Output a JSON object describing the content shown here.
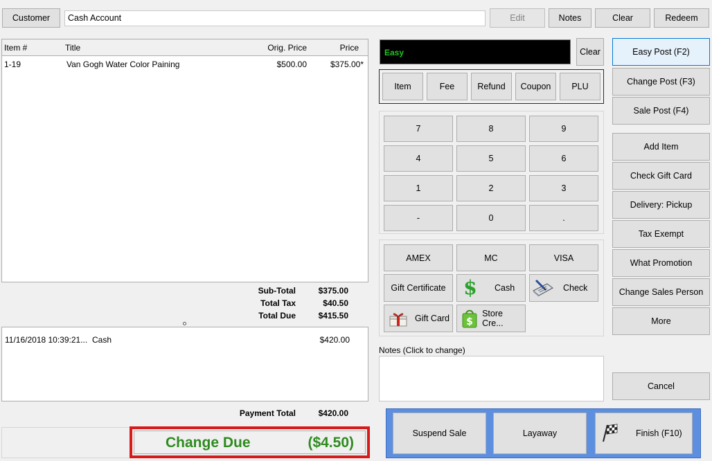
{
  "topbar": {
    "customer_button": "Customer",
    "customer_value": "Cash Account",
    "edit_button": "Edit",
    "notes_button": "Notes",
    "clear_button": "Clear",
    "redeem_button": "Redeem"
  },
  "items_table": {
    "columns": [
      "Item #",
      "Title",
      "Orig. Price",
      "Price"
    ],
    "rows": [
      {
        "item": "1-19",
        "title": "Van Gogh Water Color Paining",
        "orig_price": "$500.00",
        "price": "$375.00*"
      }
    ]
  },
  "totals": {
    "subtotal_label": "Sub-Total",
    "subtotal_value": "$375.00",
    "tax_label": "Total Tax",
    "tax_value": "$40.50",
    "due_label": "Total Due",
    "due_value": "$415.50"
  },
  "payments": {
    "rows": [
      {
        "date": "11/16/2018 10:39:21...",
        "type": "Cash",
        "amount": "$420.00"
      }
    ],
    "total_label": "Payment Total",
    "total_value": "$420.00"
  },
  "change_due": {
    "label": "Change Due",
    "value": "($4.50)",
    "color": "#2e8b1e",
    "border_color": "#d81a1a"
  },
  "entry": {
    "display_text": "Easy",
    "display_color": "#21c521",
    "clear_button": "Clear",
    "type_buttons": [
      "Item",
      "Fee",
      "Refund",
      "Coupon",
      "PLU"
    ]
  },
  "keypad": [
    "7",
    "8",
    "9",
    "4",
    "5",
    "6",
    "1",
    "2",
    "3",
    "-",
    "0",
    "."
  ],
  "tenders": {
    "amex": "AMEX",
    "mc": "MC",
    "visa": "VISA",
    "gift_certificate": "Gift Certificate",
    "cash": "Cash",
    "check": "Check",
    "gift_card": "Gift Card",
    "store_credit": "Store Cre..."
  },
  "notes": {
    "label": "Notes (Click to change)",
    "value": ""
  },
  "bottom_actions": {
    "suspend": "Suspend Sale",
    "layaway": "Layaway",
    "finish": "Finish (F10)"
  },
  "right_panel": {
    "easy_post": "Easy Post (F2)",
    "change_post": "Change Post (F3)",
    "sale_post": "Sale Post (F4)",
    "add_item": "Add Item",
    "check_gift_card": "Check Gift Card",
    "delivery": "Delivery: Pickup",
    "tax_exempt": "Tax Exempt",
    "what_promotion": "What Promotion",
    "change_sales_person": "Change Sales Person",
    "more": "More",
    "cancel": "Cancel"
  }
}
